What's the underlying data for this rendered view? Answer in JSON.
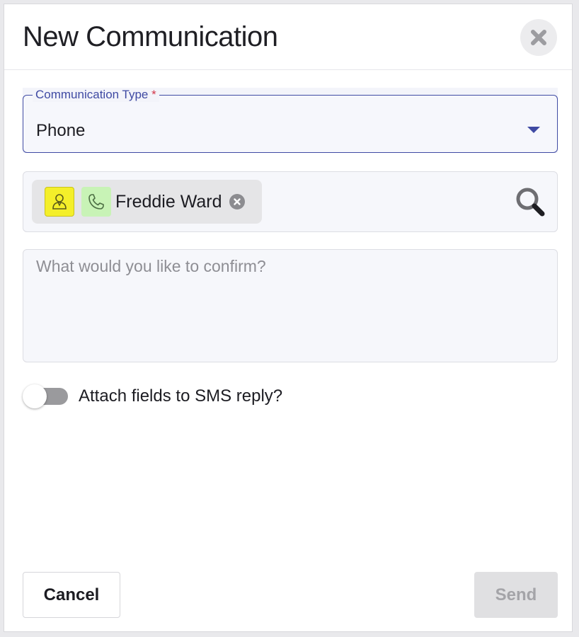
{
  "dialog": {
    "title": "New Communication",
    "close_icon": "close-icon"
  },
  "communication_type": {
    "label": "Communication Type",
    "required_marker": "*",
    "value": "Phone"
  },
  "recipients": {
    "chips": [
      {
        "name": "Freddie Ward",
        "type_icon": "contact-person-icon",
        "channel_icon": "phone-icon"
      }
    ],
    "search_icon": "search-icon"
  },
  "message": {
    "placeholder": "What would you like to confirm?",
    "value": ""
  },
  "sms_toggle": {
    "label": "Attach fields to SMS reply?",
    "checked": false
  },
  "footer": {
    "cancel_label": "Cancel",
    "send_label": "Send"
  },
  "colors": {
    "accent": "#3f4aa3",
    "required": "#d3374a",
    "contact_icon_bg": "#f4ef2a",
    "phone_icon_bg": "#c8f3b6"
  }
}
